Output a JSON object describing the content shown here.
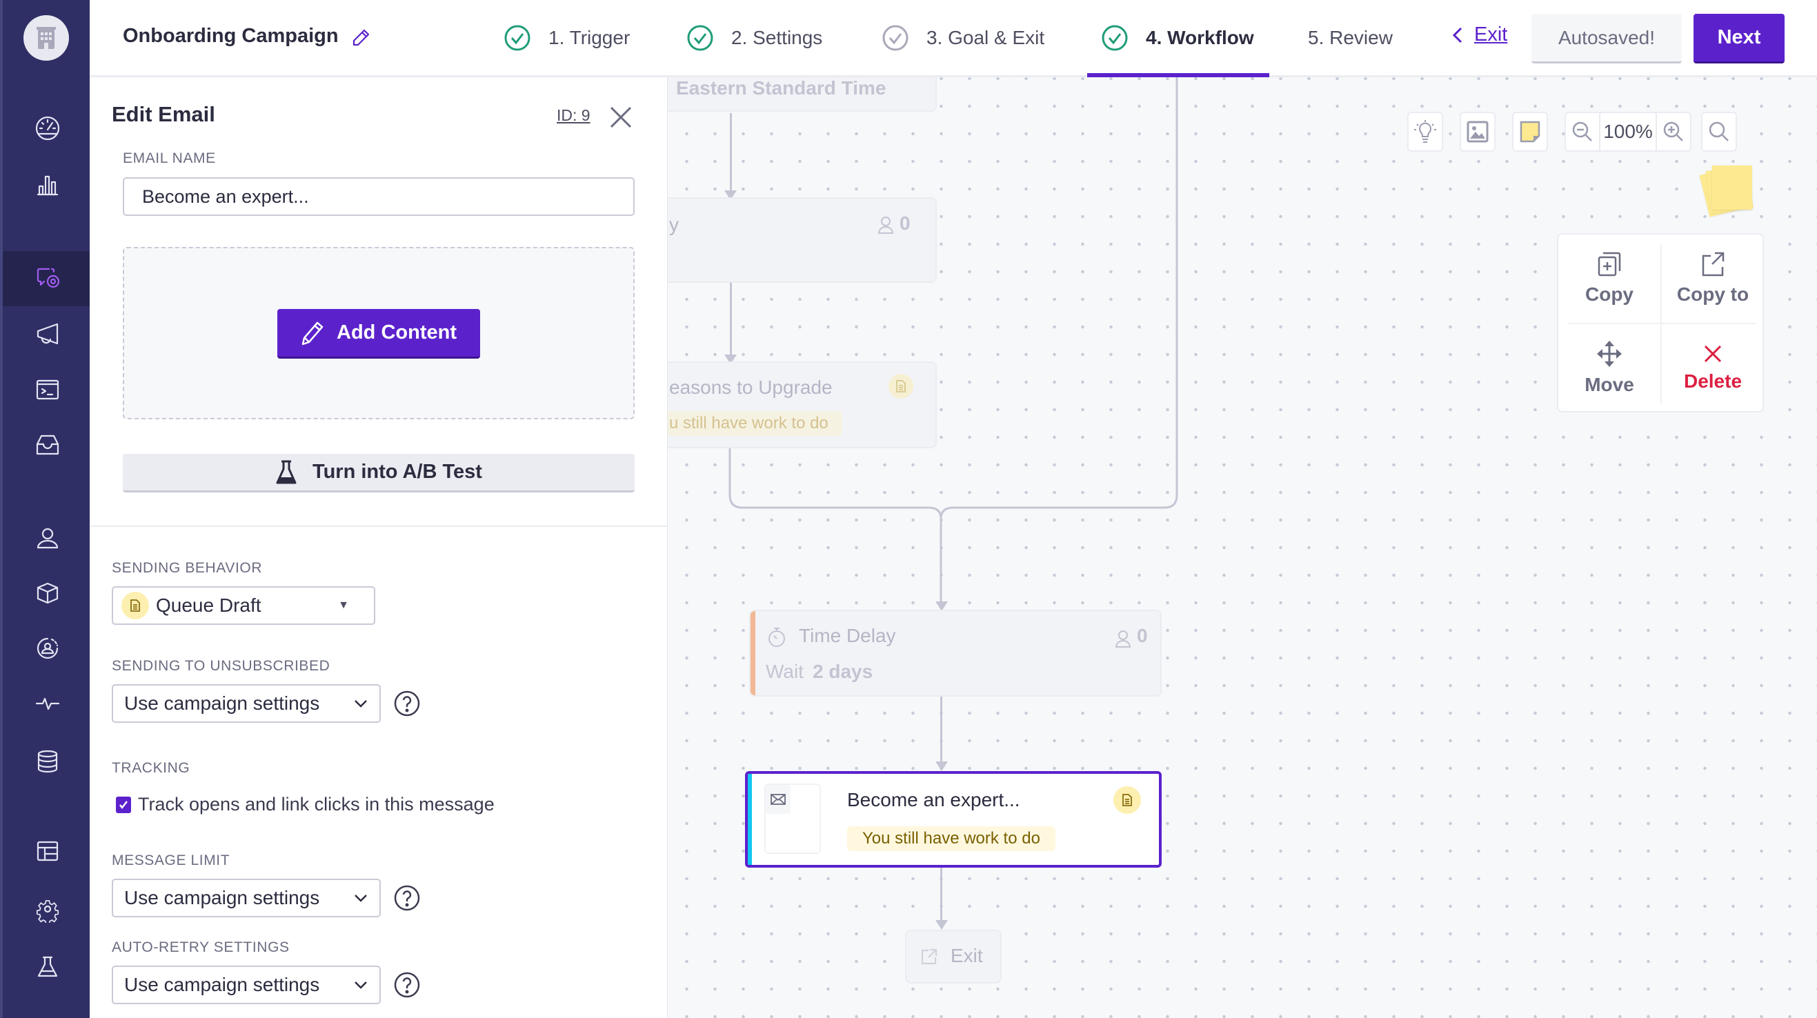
{
  "app": {
    "campaign_title": "Onboarding Campaign",
    "logo_icon": "building-icon"
  },
  "sidebar": {
    "items": [
      {
        "icon": "dashboard-gauge-icon",
        "active": false
      },
      {
        "icon": "bar-chart-icon",
        "active": false
      },
      {
        "icon": "campaigns-message-icon",
        "active": true
      },
      {
        "icon": "megaphone-icon",
        "active": false
      },
      {
        "icon": "terminal-icon",
        "active": false
      },
      {
        "icon": "inbox-icon",
        "active": false
      },
      {
        "icon": "person-icon",
        "active": false
      },
      {
        "icon": "box-icon",
        "active": false
      },
      {
        "icon": "segment-person-icon",
        "active": false
      },
      {
        "icon": "activity-pulse-icon",
        "active": false
      },
      {
        "icon": "database-icon",
        "active": false
      },
      {
        "icon": "table-layout-icon",
        "active": false
      },
      {
        "icon": "gear-icon",
        "active": false
      },
      {
        "icon": "flask-icon",
        "active": false
      }
    ],
    "active_color": "#a35cf0"
  },
  "header": {
    "steps": [
      {
        "label": "1. Trigger",
        "status": "complete"
      },
      {
        "label": "2. Settings",
        "status": "complete"
      },
      {
        "label": "3. Goal & Exit",
        "status": "incomplete"
      },
      {
        "label": "4. Workflow",
        "status": "complete",
        "active": true
      },
      {
        "label": "5. Review",
        "status": "none"
      }
    ],
    "exit_label": "Exit",
    "autosaved_label": "Autosaved!",
    "next_label": "Next",
    "accent_color": "#5b22cc",
    "complete_color": "#1e9c78"
  },
  "panel": {
    "title": "Edit Email",
    "id_label": "ID: 9",
    "email_name_label": "EMAIL NAME",
    "email_name_value": "Become an expert...",
    "add_content_label": "Add Content",
    "ab_test_label": "Turn into A/B Test",
    "sending_behavior": {
      "label": "SENDING BEHAVIOR",
      "value": "Queue Draft"
    },
    "sending_unsubscribed": {
      "label": "SENDING TO UNSUBSCRIBED",
      "value": "Use campaign settings"
    },
    "tracking": {
      "label": "TRACKING",
      "checkbox_label": "Track opens and link clicks in this message",
      "checked": true
    },
    "message_limit": {
      "label": "MESSAGE LIMIT",
      "value": "Use campaign settings"
    },
    "auto_retry": {
      "label": "AUTO-RETRY SETTINGS",
      "value": "Use campaign settings"
    }
  },
  "canvas": {
    "toolbar": {
      "zoom_level": "100%"
    },
    "nodes": {
      "timezone": {
        "text": "Eastern Standard Time"
      },
      "node2": {
        "title_fragment": "y",
        "count": "0"
      },
      "upgrade_email": {
        "title": "easons to Upgrade",
        "status": "u still have work to do"
      },
      "time_delay": {
        "title": "Time Delay",
        "wait_prefix": "Wait",
        "wait_value": "2 days",
        "count": "0"
      },
      "selected_email": {
        "title": "Become an expert...",
        "status": "You still have work to do"
      },
      "exit": {
        "label": "Exit"
      }
    },
    "context_menu": {
      "copy": "Copy",
      "copy_to": "Copy to",
      "move": "Move",
      "delete": "Delete",
      "delete_color": "#dc2041"
    }
  }
}
